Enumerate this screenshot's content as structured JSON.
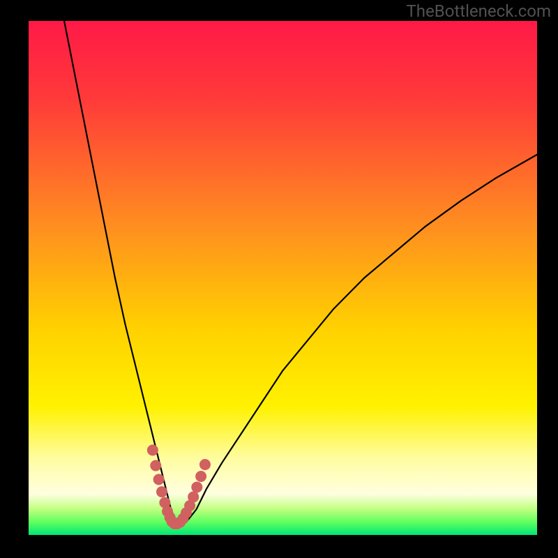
{
  "watermark": "TheBottleneck.com",
  "chart_data": {
    "type": "line",
    "title": "",
    "xlabel": "",
    "ylabel": "",
    "xlim": [
      0,
      100
    ],
    "ylim": [
      0,
      100
    ],
    "gradient_stops": [
      {
        "offset": 0,
        "color": "#ff1a47"
      },
      {
        "offset": 15,
        "color": "#ff3a3a"
      },
      {
        "offset": 40,
        "color": "#ff8f20"
      },
      {
        "offset": 60,
        "color": "#ffd200"
      },
      {
        "offset": 75,
        "color": "#fff200"
      },
      {
        "offset": 85,
        "color": "#fffda0"
      },
      {
        "offset": 92,
        "color": "#ffffe0"
      },
      {
        "offset": 95,
        "color": "#c0ff80"
      },
      {
        "offset": 97.5,
        "color": "#60ff60"
      },
      {
        "offset": 100,
        "color": "#00e676"
      }
    ],
    "series": [
      {
        "name": "bottleneck-curve",
        "color": "#000000",
        "x": [
          7,
          9,
          11,
          13,
          15,
          17,
          19,
          21,
          23,
          25,
          26,
          27,
          28,
          29,
          30,
          31,
          33,
          35,
          38,
          42,
          46,
          50,
          55,
          60,
          66,
          72,
          78,
          85,
          92,
          100
        ],
        "y": [
          100,
          90,
          80,
          70,
          60,
          50,
          41,
          33,
          25,
          17,
          13,
          9,
          5,
          2.5,
          2,
          2.5,
          5,
          9,
          14,
          20,
          26,
          32,
          38,
          44,
          50,
          55,
          60,
          65,
          69.5,
          74
        ]
      },
      {
        "name": "valley-highlight-dots",
        "color": "#d16060",
        "x": [
          24.4,
          25.0,
          25.6,
          26.2,
          26.8,
          27.3,
          27.8,
          28.2,
          28.7,
          29.2,
          29.8,
          30.4,
          31.0,
          31.7,
          32.4,
          33.1,
          33.9,
          34.7
        ],
        "y": [
          16.5,
          13.5,
          10.8,
          8.4,
          6.3,
          4.6,
          3.4,
          2.6,
          2.2,
          2.2,
          2.5,
          3.2,
          4.3,
          5.7,
          7.4,
          9.3,
          11.4,
          13.7
        ]
      }
    ]
  }
}
